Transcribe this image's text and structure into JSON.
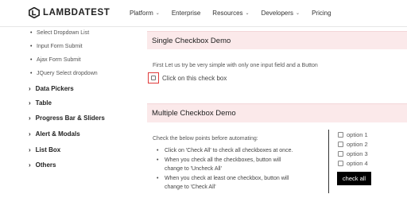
{
  "header": {
    "logo_text": "LAMBDATEST",
    "nav": [
      {
        "label": "Platform",
        "has_dropdown": true
      },
      {
        "label": "Enterprise",
        "has_dropdown": false
      },
      {
        "label": "Resources",
        "has_dropdown": true
      },
      {
        "label": "Developers",
        "has_dropdown": true
      },
      {
        "label": "Pricing",
        "has_dropdown": false
      }
    ],
    "chevron": "⌄"
  },
  "sidebar": {
    "sub_items": [
      "Select Dropdown List",
      "Input Form Submit",
      "Ajax Form Submit",
      "JQuery Select dropdown"
    ],
    "main_items": [
      "Data Pickers",
      "Table",
      "Progress Bar & Sliders",
      "Alert & Modals",
      "List Box",
      "Others"
    ],
    "arrow": "›"
  },
  "single": {
    "title": "Single Checkbox Demo",
    "intro": "First Let us try be very simple with only one input field and a Button",
    "checkbox_label": "Click on this check box"
  },
  "multiple": {
    "title": "Multiple Checkbox Demo",
    "intro": "Check the below points before automating:",
    "bullets": [
      "Click on 'Check All' to check all checkboxes at once.",
      "When you check all the checkboxes, button will",
      "change to 'Uncheck All'",
      "When you check at least one checkbox, button will",
      "change to 'Check All'"
    ],
    "options": [
      "option 1",
      "option 2",
      "option 3",
      "option 4"
    ],
    "button_label": "check all"
  },
  "colors": {
    "section_bg": "#fbe9ea",
    "highlight": "#e03b3b",
    "button_bg": "#000000"
  }
}
